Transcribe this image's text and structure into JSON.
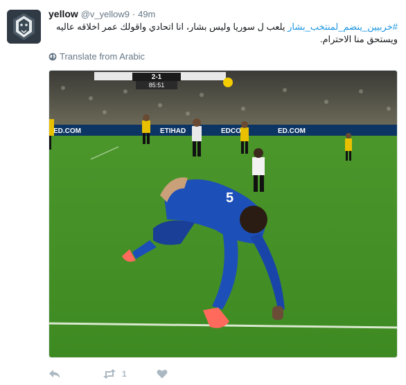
{
  "tweet": {
    "fullname": "yellow",
    "username": "@v_yellow9",
    "separator": "·",
    "time": "49m",
    "hashtag": "#خربيين_ينضم_لمنتخب_بشار",
    "body": " يلعب ل سوريا وليس بشار، انا اتحادي واقولك عمر اخلاقه عاليه ويستحق منا الاحترام.",
    "translate_label": "Translate from Arabic",
    "retweet_count": "1"
  },
  "media": {
    "scoreboard_score": "2-1",
    "scoreboard_clock": "85:51",
    "ad_texts": [
      "ED.COM",
      "ETIHAD",
      "EDCOM",
      "ED.COM"
    ]
  },
  "icons": {
    "avatar": "lion-avatar-icon",
    "globe": "globe-icon",
    "reply": "reply-icon",
    "retweet": "retweet-icon",
    "like": "heart-icon"
  }
}
